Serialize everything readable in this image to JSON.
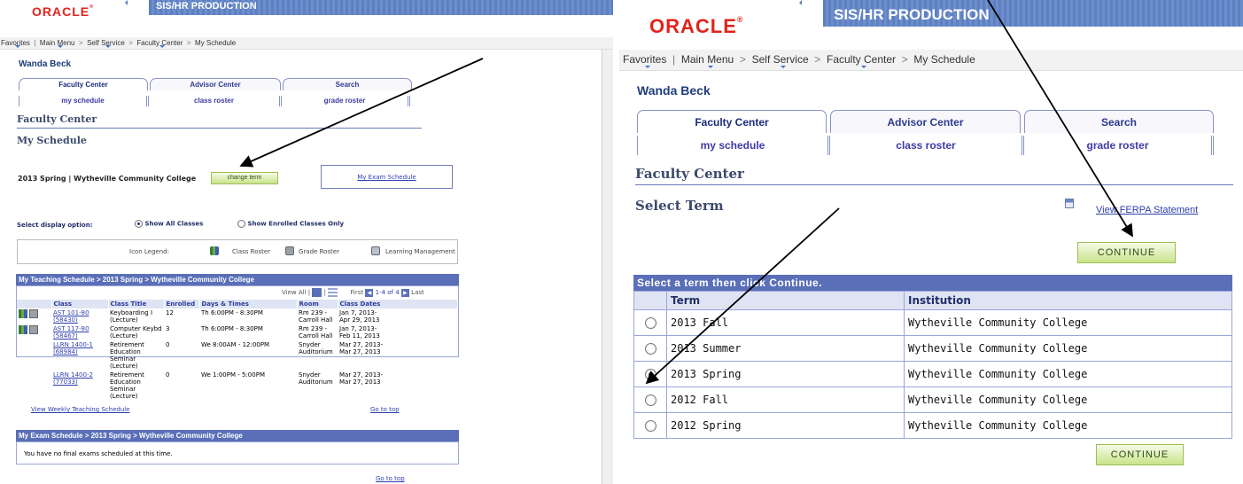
{
  "left": {
    "banner_title": "SIS/HR PRODUCTION",
    "logo": "ORACLE",
    "nav": [
      "Favorites",
      "Main Menu",
      "Self Service",
      "Faculty Center",
      "My Schedule"
    ],
    "user": "Wanda Beck",
    "tabs": [
      "Faculty Center",
      "Advisor Center",
      "Search"
    ],
    "subtabs": [
      "my schedule",
      "class roster",
      "grade roster"
    ],
    "section_title": "Faculty Center",
    "page_title": "My Schedule",
    "term_text": "2013 Spring | Wytheville Community College",
    "change_term": "change term",
    "exam_link": "My Exam Schedule",
    "display_label": "Select display option:",
    "opt_all": "Show All Classes",
    "opt_enrolled": "Show Enrolled Classes Only",
    "legend_label": "Icon Legend:",
    "legend_items": [
      "Class Roster",
      "Grade Roster",
      "Learning Management"
    ],
    "teaching_header": "My Teaching Schedule > 2013 Spring > Wytheville Community College",
    "view_all": "View All |",
    "first": "First",
    "range": "1-4 of 4",
    "last": "Last",
    "columns": [
      "Class",
      "Class Title",
      "Enrolled",
      "Days & Times",
      "Room",
      "Class Dates"
    ],
    "rows": [
      {
        "class1": "AST 101-80",
        "class2": "(58430)",
        "title1": "Keyboarding I",
        "title2": "(Lecture)",
        "enrolled": "12",
        "times": "Th 6:00PM - 8:30PM",
        "room1": "Rm 239 -",
        "room2": "Carroll Hall",
        "dates1": "Jan 7, 2013-",
        "dates2": "Apr 29, 2013"
      },
      {
        "class1": "AST 117-80",
        "class2": "(58467)",
        "title1": "Computer Keybd",
        "title2": "(Lecture)",
        "enrolled": "3",
        "times": "Th 6:00PM - 8:30PM",
        "room1": "Rm 239 -",
        "room2": "Carroll Hall",
        "dates1": "Jan 7, 2013-",
        "dates2": "Feb 11, 2013"
      },
      {
        "class1": "LLRN 1400-1",
        "class2": "(68984)",
        "title1": "Retirement Education",
        "title2": "Seminar (Lecture)",
        "enrolled": "0",
        "times": "We 8:00AM - 12:00PM",
        "room1": "Snyder",
        "room2": "Auditorium",
        "dates1": "Mar 27, 2013-",
        "dates2": "Mar 27, 2013"
      },
      {
        "class1": "LLRN 1400-2",
        "class2": "(77033)",
        "title1": "Retirement Education",
        "title2": "Seminar (Lecture)",
        "enrolled": "0",
        "times": "We 1:00PM - 5:00PM",
        "room1": "Snyder",
        "room2": "Auditorium",
        "dates1": "Mar 27, 2013-",
        "dates2": "Mar 27, 2013"
      }
    ],
    "weekly_link": "View Weekly Teaching Schedule",
    "go_top": "Go to top",
    "exam_header": "My Exam Schedule > 2013 Spring > Wytheville Community College",
    "exam_text": "You have no final exams scheduled at this time.",
    "go_top2": "Go to top"
  },
  "right": {
    "banner_title": "SIS/HR PRODUCTION",
    "logo": "ORACLE",
    "nav": [
      "Favorites",
      "Main Menu",
      "Self Service",
      "Faculty Center",
      "My Schedule"
    ],
    "user": "Wanda Beck",
    "tabs": [
      "Faculty Center",
      "Advisor Center",
      "Search"
    ],
    "subtabs": [
      "my schedule",
      "class roster",
      "grade roster"
    ],
    "section_title": "Faculty Center",
    "page_title": "Select Term",
    "ferpa": "View FERPA Statement",
    "continue": "CONTINUE",
    "grid_header": "Select a term then click Continue.",
    "col_term": "Term",
    "col_inst": "Institution",
    "terms": [
      {
        "term": "2013 Fall",
        "inst": "Wytheville Community College",
        "selected": false
      },
      {
        "term": "2013 Summer",
        "inst": "Wytheville Community College",
        "selected": false
      },
      {
        "term": "2013 Spring",
        "inst": "Wytheville Community College",
        "selected": true
      },
      {
        "term": "2012 Fall",
        "inst": "Wytheville Community College",
        "selected": false
      },
      {
        "term": "2012 Spring",
        "inst": "Wytheville Community College",
        "selected": false
      }
    ],
    "continue2": "CONTINUE"
  },
  "colors": {
    "oracle_red": "#e2231a",
    "banner_blue": "#5e80c0",
    "grid_blue": "#5a6fb8",
    "button_green": "#c9e38a",
    "link_blue": "#2c3fae"
  }
}
